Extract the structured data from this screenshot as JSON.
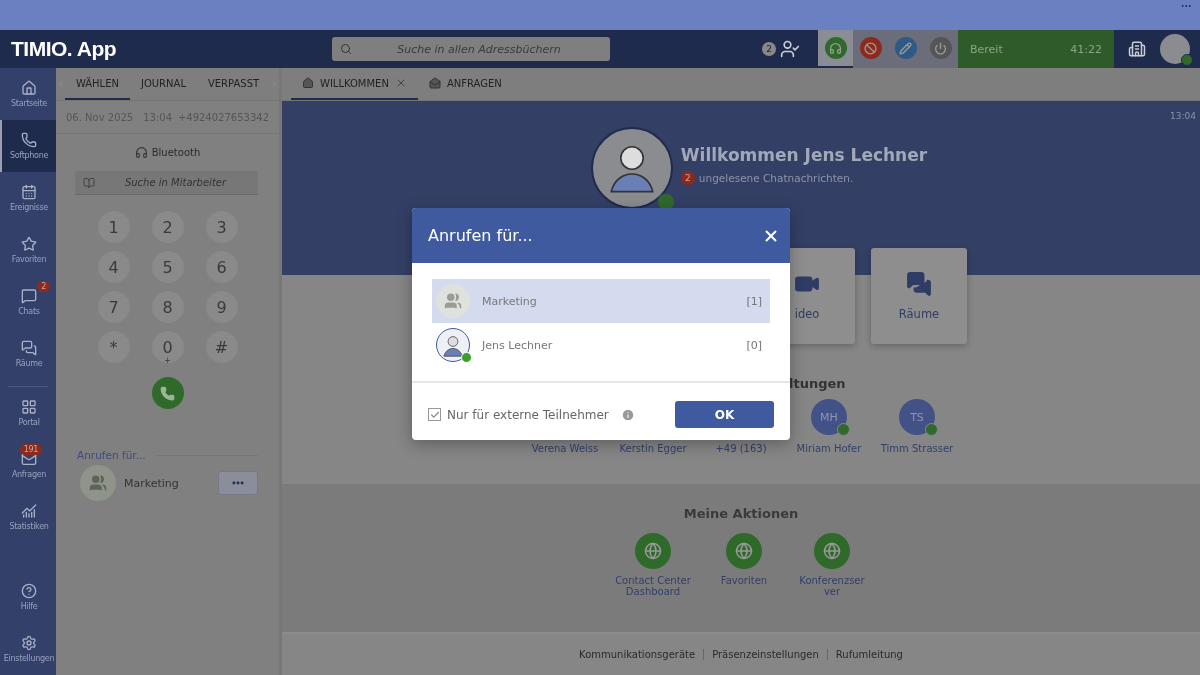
{
  "header": {
    "logo": "TIMIO. App",
    "search": {
      "placeholder": "Suche in allen Adressbüchern"
    },
    "presence_count": "2",
    "tools": [
      {
        "kind": "headset",
        "selected": true
      },
      {
        "kind": "block",
        "selected": false
      },
      {
        "kind": "edit",
        "selected": false
      },
      {
        "kind": "power",
        "selected": false
      }
    ],
    "status": {
      "label": "Bereit",
      "timer": "41:22"
    }
  },
  "nav": {
    "groups": [
      {
        "items": [
          {
            "kind": "home",
            "label": "Startseite",
            "selected": false
          },
          {
            "kind": "phone",
            "label": "Softphone",
            "selected": true
          },
          {
            "kind": "calendar",
            "label": "Ereignisse",
            "selected": false
          },
          {
            "kind": "star",
            "label": "Favoriten",
            "selected": false
          },
          {
            "kind": "chat",
            "label": "Chats",
            "badge": "2",
            "selected": false
          },
          {
            "kind": "rooms",
            "label": "Räume",
            "selected": false
          }
        ]
      },
      {
        "items": [
          {
            "kind": "grid",
            "label": "Portal",
            "selected": false
          },
          {
            "kind": "mail",
            "label": "Anfragen",
            "badge": "191",
            "selected": false
          },
          {
            "kind": "chart",
            "label": "Statistiken",
            "selected": false
          }
        ]
      },
      {
        "items": [
          {
            "kind": "help",
            "label": "Hilfe",
            "selected": false
          },
          {
            "kind": "settings",
            "label": "Einstellungen",
            "selected": false
          }
        ]
      }
    ]
  },
  "dialer": {
    "tabs": [
      {
        "label": "WÄHLEN",
        "selected": true
      },
      {
        "label": "JOURNAL",
        "selected": false
      },
      {
        "label": "VERPASST",
        "selected": false
      }
    ],
    "date": "06. Nov 2025",
    "time": "13:04",
    "number": "+4924027653342",
    "device": "Bluetooth",
    "search": {
      "placeholder": "Suche in Mitarbeiter"
    },
    "keys": [
      {
        "digit": "1"
      },
      {
        "digit": "2"
      },
      {
        "digit": "3"
      },
      {
        "digit": "4"
      },
      {
        "digit": "5"
      },
      {
        "digit": "6"
      },
      {
        "digit": "7"
      },
      {
        "digit": "8"
      },
      {
        "digit": "9"
      },
      {
        "digit": "*"
      },
      {
        "digit": "0",
        "sub": "+"
      },
      {
        "digit": "#"
      }
    ],
    "call_for": {
      "title": "Anrufen für...",
      "name": "Marketing"
    }
  },
  "main": {
    "tabs": [
      {
        "kind": "home",
        "label": "WILLKOMMEN",
        "closable": true,
        "selected": true
      },
      {
        "kind": "mail",
        "label": "ANFRAGEN",
        "selected": false
      }
    ],
    "clock": "13:04",
    "welcome": {
      "title": "Willkommen Jens Lechner",
      "unread_count": "2",
      "unread_text": "ungelesene Chatnachrichten."
    },
    "tiles": [
      {
        "kind": "hidden"
      },
      {
        "kind": "hidden"
      },
      {
        "kind": "video",
        "label": "ideo"
      },
      {
        "kind": "rooms",
        "label": "Räume"
      }
    ],
    "contacts_heading": "ltungen",
    "contacts": [
      {
        "name": "Verena Weiss"
      },
      {
        "name": "Kerstin Egger"
      },
      {
        "name": "+49 (163)"
      },
      {
        "name": "Miriam Hofer",
        "initials": "MH",
        "online": true
      },
      {
        "name": "Timm Strasser",
        "initials": "TS",
        "online": true
      }
    ],
    "actions": {
      "title": "Meine Aktionen",
      "items": [
        {
          "label": "Contact Center Dashboard"
        },
        {
          "label": "Favoriten"
        },
        {
          "label": "Konferenzserver"
        }
      ]
    },
    "footer_links": [
      "Kommunikationsgeräte",
      "Präsenzeinstellungen",
      "Rufumleitung"
    ]
  },
  "dialog": {
    "title": "Anrufen für...",
    "options": [
      {
        "kind": "group",
        "name": "Marketing",
        "count": "[1]",
        "selected": true
      },
      {
        "kind": "person",
        "name": "Jens Lechner",
        "count": "[0]",
        "selected": false
      }
    ],
    "external_only": {
      "label": "Nur für externe Teilnehmer",
      "checked": true
    },
    "ok": "OK"
  }
}
